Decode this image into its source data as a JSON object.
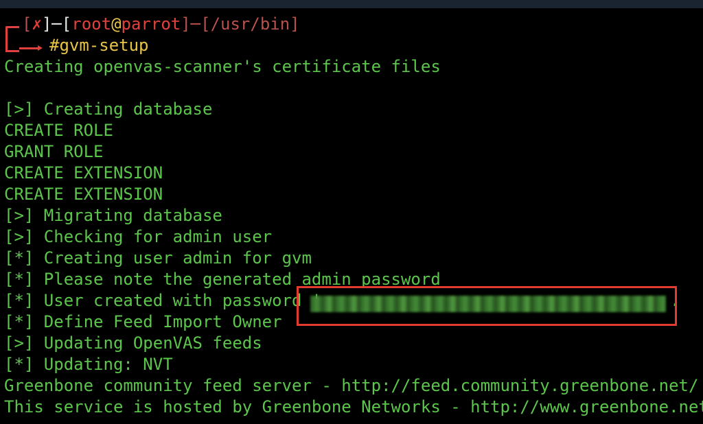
{
  "prompt": {
    "open_bracket": "[",
    "status_symbol": "✗",
    "close_bracket_dash": "]─[",
    "user": "root",
    "at": "@",
    "host": "parrot",
    "mid": "]─[",
    "path": "/usr/bin",
    "end": "]",
    "command_hash": "#",
    "command": "gvm-setup"
  },
  "lines": [
    "Creating openvas-scanner's certificate files",
    "",
    "[>] Creating database",
    "CREATE ROLE",
    "GRANT ROLE",
    "CREATE EXTENSION",
    "CREATE EXTENSION",
    "[>] Migrating database",
    "[>] Checking for admin user",
    "[*] Creating user admin for gvm",
    "[*] Please note the generated admin password",
    "[*] User created with password '",
    "[*] Define Feed Import Owner",
    "[>] Updating OpenVAS feeds",
    "[*] Updating: NVT",
    "Greenbone community feed server - http://feed.community.greenbone.net/",
    "This service is hosted by Greenbone Networks - http://www.greenbone.net/"
  ],
  "password_suffix": ".",
  "colors": {
    "output_green": "#5cc54b",
    "prompt_red": "#e0413c",
    "host_yellow": "#e8c547",
    "highlight_red": "#e23b2f",
    "background": "#000000"
  }
}
